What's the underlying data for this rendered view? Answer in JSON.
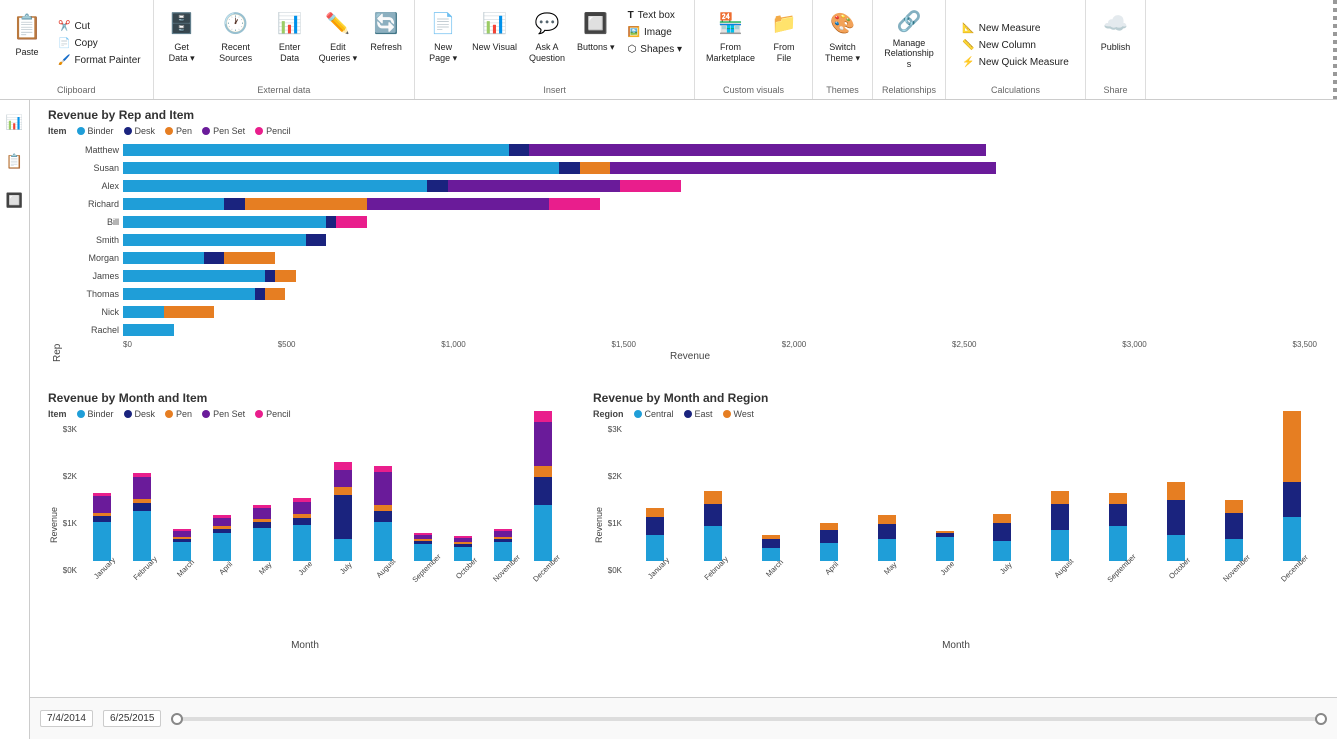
{
  "ribbon": {
    "groups": [
      {
        "name": "clipboard",
        "label": "Clipboard",
        "buttons": [
          {
            "id": "paste",
            "icon": "📋",
            "label": "Paste",
            "size": "large"
          },
          {
            "id": "cut",
            "icon": "✂️",
            "label": "Cut",
            "size": "small"
          },
          {
            "id": "copy",
            "icon": "📄",
            "label": "Copy",
            "size": "small"
          },
          {
            "id": "format-painter",
            "icon": "🖌️",
            "label": "Format Painter",
            "size": "small"
          }
        ]
      },
      {
        "name": "external-data",
        "label": "External data",
        "buttons": [
          {
            "id": "get-data",
            "icon": "🗄️",
            "label": "Get Data",
            "size": "large"
          },
          {
            "id": "recent-sources",
            "icon": "🕐",
            "label": "Recent Sources",
            "size": "large"
          },
          {
            "id": "enter-data",
            "icon": "📊",
            "label": "Enter Data",
            "size": "large"
          },
          {
            "id": "edit-queries",
            "icon": "✏️",
            "label": "Edit Queries",
            "size": "large"
          },
          {
            "id": "refresh",
            "icon": "🔄",
            "label": "Refresh",
            "size": "large"
          }
        ]
      },
      {
        "name": "insert",
        "label": "Insert",
        "buttons": [
          {
            "id": "new-page",
            "icon": "📄",
            "label": "New Page",
            "size": "large"
          },
          {
            "id": "new-visual",
            "icon": "📊",
            "label": "New Visual",
            "size": "large"
          },
          {
            "id": "ask-a-question",
            "icon": "💬",
            "label": "Ask A Question",
            "size": "large"
          },
          {
            "id": "buttons",
            "icon": "🔲",
            "label": "Buttons",
            "size": "large"
          },
          {
            "id": "text-box",
            "icon": "T",
            "label": "Text box",
            "size": "small"
          },
          {
            "id": "image",
            "icon": "🖼️",
            "label": "Image",
            "size": "small"
          },
          {
            "id": "shapes",
            "icon": "⬡",
            "label": "Shapes",
            "size": "small"
          }
        ]
      },
      {
        "name": "custom-visuals",
        "label": "Custom visuals",
        "buttons": [
          {
            "id": "from-marketplace",
            "icon": "🏪",
            "label": "From Marketplace",
            "size": "large"
          },
          {
            "id": "from-file",
            "icon": "📁",
            "label": "From File",
            "size": "large"
          }
        ]
      },
      {
        "name": "themes",
        "label": "Themes",
        "buttons": [
          {
            "id": "switch-theme",
            "icon": "🎨",
            "label": "Switch Theme",
            "size": "large"
          }
        ]
      },
      {
        "name": "relationships",
        "label": "Relationships",
        "buttons": [
          {
            "id": "manage-relationships",
            "icon": "🔗",
            "label": "Manage Relationships",
            "size": "large"
          }
        ]
      },
      {
        "name": "calculations",
        "label": "Calculations",
        "buttons": [
          {
            "id": "new-measure",
            "icon": "📐",
            "label": "New Measure",
            "size": "small"
          },
          {
            "id": "new-column",
            "icon": "📏",
            "label": "New Column",
            "size": "small"
          },
          {
            "id": "new-quick-measure",
            "icon": "⚡",
            "label": "New Quick Measure",
            "size": "small"
          }
        ]
      },
      {
        "name": "share",
        "label": "Share",
        "buttons": [
          {
            "id": "publish",
            "icon": "☁️",
            "label": "Publish",
            "size": "large"
          }
        ]
      }
    ]
  },
  "charts": {
    "top": {
      "title": "Revenue by Rep and Item",
      "legend_label": "Item",
      "legend_items": [
        {
          "label": "Binder",
          "color": "#1f9ed8"
        },
        {
          "label": "Desk",
          "color": "#1a237e"
        },
        {
          "label": "Pen",
          "color": "#e67e22"
        },
        {
          "label": "Pen Set",
          "color": "#6a1b9a"
        },
        {
          "label": "Pencil",
          "color": "#e91e8c"
        }
      ],
      "reps": [
        {
          "name": "Matthew",
          "bars": [
            {
              "color": "#1f9ed8",
              "pct": 38
            },
            {
              "color": "#1a237e",
              "pct": 2
            },
            {
              "color": "#e67e22",
              "pct": 0
            },
            {
              "color": "#6a1b9a",
              "pct": 45
            },
            {
              "color": "#e91e8c",
              "pct": 0
            }
          ]
        },
        {
          "name": "Susan",
          "bars": [
            {
              "color": "#1f9ed8",
              "pct": 43
            },
            {
              "color": "#1a237e",
              "pct": 2
            },
            {
              "color": "#e67e22",
              "pct": 3
            },
            {
              "color": "#6a1b9a",
              "pct": 38
            },
            {
              "color": "#e91e8c",
              "pct": 0
            }
          ]
        },
        {
          "name": "Alex",
          "bars": [
            {
              "color": "#1f9ed8",
              "pct": 30
            },
            {
              "color": "#1a237e",
              "pct": 2
            },
            {
              "color": "#e67e22",
              "pct": 0
            },
            {
              "color": "#6a1b9a",
              "pct": 17
            },
            {
              "color": "#e91e8c",
              "pct": 6
            }
          ]
        },
        {
          "name": "Richard",
          "bars": [
            {
              "color": "#1f9ed8",
              "pct": 10
            },
            {
              "color": "#1a237e",
              "pct": 2
            },
            {
              "color": "#e67e22",
              "pct": 12
            },
            {
              "color": "#6a1b9a",
              "pct": 18
            },
            {
              "color": "#e91e8c",
              "pct": 5
            }
          ]
        },
        {
          "name": "Bill",
          "bars": [
            {
              "color": "#1f9ed8",
              "pct": 20
            },
            {
              "color": "#1a237e",
              "pct": 1
            },
            {
              "color": "#e67e22",
              "pct": 0
            },
            {
              "color": "#6a1b9a",
              "pct": 0
            },
            {
              "color": "#e91e8c",
              "pct": 3
            }
          ]
        },
        {
          "name": "Smith",
          "bars": [
            {
              "color": "#1f9ed8",
              "pct": 18
            },
            {
              "color": "#1a237e",
              "pct": 2
            },
            {
              "color": "#e67e22",
              "pct": 0
            },
            {
              "color": "#6a1b9a",
              "pct": 0
            },
            {
              "color": "#e91e8c",
              "pct": 0
            }
          ]
        },
        {
          "name": "Morgan",
          "bars": [
            {
              "color": "#1f9ed8",
              "pct": 8
            },
            {
              "color": "#1a237e",
              "pct": 2
            },
            {
              "color": "#e67e22",
              "pct": 5
            },
            {
              "color": "#6a1b9a",
              "pct": 0
            },
            {
              "color": "#e91e8c",
              "pct": 0
            }
          ]
        },
        {
          "name": "James",
          "bars": [
            {
              "color": "#1f9ed8",
              "pct": 14
            },
            {
              "color": "#1a237e",
              "pct": 1
            },
            {
              "color": "#e67e22",
              "pct": 2
            },
            {
              "color": "#6a1b9a",
              "pct": 0
            },
            {
              "color": "#e91e8c",
              "pct": 0
            }
          ]
        },
        {
          "name": "Thomas",
          "bars": [
            {
              "color": "#1f9ed8",
              "pct": 13
            },
            {
              "color": "#1a237e",
              "pct": 1
            },
            {
              "color": "#e67e22",
              "pct": 2
            },
            {
              "color": "#6a1b9a",
              "pct": 0
            },
            {
              "color": "#e91e8c",
              "pct": 0
            }
          ]
        },
        {
          "name": "Nick",
          "bars": [
            {
              "color": "#1f9ed8",
              "pct": 4
            },
            {
              "color": "#1a237e",
              "pct": 0
            },
            {
              "color": "#e67e22",
              "pct": 5
            },
            {
              "color": "#6a1b9a",
              "pct": 0
            },
            {
              "color": "#e91e8c",
              "pct": 0
            }
          ]
        },
        {
          "name": "Rachel",
          "bars": [
            {
              "color": "#1f9ed8",
              "pct": 5
            },
            {
              "color": "#1a237e",
              "pct": 0
            },
            {
              "color": "#e67e22",
              "pct": 0
            },
            {
              "color": "#6a1b9a",
              "pct": 0
            },
            {
              "color": "#e91e8c",
              "pct": 0
            }
          ]
        }
      ],
      "x_axis": [
        "$0",
        "$500",
        "$1,000",
        "$1,500",
        "$2,000",
        "$2,500",
        "$3,000",
        "$3,500"
      ],
      "x_title": "Revenue",
      "y_title": "Rep"
    },
    "bottom_left": {
      "title": "Revenue by Month and Item",
      "legend_label": "Item",
      "legend_items": [
        {
          "label": "Binder",
          "color": "#1f9ed8"
        },
        {
          "label": "Desk",
          "color": "#1a237e"
        },
        {
          "label": "Pen",
          "color": "#e67e22"
        },
        {
          "label": "Pen Set",
          "color": "#6a1b9a"
        },
        {
          "label": "Pencil",
          "color": "#e91e8c"
        }
      ],
      "months": [
        "January",
        "February",
        "March",
        "April",
        "May",
        "June",
        "July",
        "August",
        "September",
        "October",
        "November",
        "December"
      ],
      "month_data": [
        [
          70,
          10,
          5,
          30,
          5
        ],
        [
          90,
          15,
          8,
          40,
          8
        ],
        [
          35,
          5,
          3,
          10,
          3
        ],
        [
          50,
          8,
          5,
          15,
          5
        ],
        [
          60,
          10,
          6,
          20,
          6
        ],
        [
          65,
          12,
          7,
          22,
          7
        ],
        [
          40,
          80,
          15,
          30,
          15
        ],
        [
          70,
          20,
          10,
          60,
          10
        ],
        [
          30,
          5,
          3,
          8,
          3
        ],
        [
          25,
          5,
          3,
          8,
          3
        ],
        [
          35,
          5,
          4,
          10,
          4
        ],
        [
          100,
          50,
          20,
          80,
          20
        ]
      ],
      "x_title": "Month",
      "y_title": "Revenue",
      "y_labels": [
        "$0K",
        "$1K",
        "$2K",
        "$3K"
      ]
    },
    "bottom_right": {
      "title": "Revenue by Month and Region",
      "legend_label": "Region",
      "legend_items": [
        {
          "label": "Central",
          "color": "#1f9ed8"
        },
        {
          "label": "East",
          "color": "#1a237e"
        },
        {
          "label": "West",
          "color": "#e67e22"
        }
      ],
      "months": [
        "January",
        "February",
        "March",
        "April",
        "May",
        "June",
        "July",
        "August",
        "September",
        "October",
        "November",
        "December"
      ],
      "month_data": [
        [
          60,
          40,
          20
        ],
        [
          80,
          50,
          30
        ],
        [
          30,
          20,
          10
        ],
        [
          40,
          30,
          15
        ],
        [
          50,
          35,
          20
        ],
        [
          55,
          10,
          5
        ],
        [
          45,
          40,
          20
        ],
        [
          70,
          60,
          30
        ],
        [
          80,
          50,
          25
        ],
        [
          60,
          80,
          40
        ],
        [
          50,
          60,
          30
        ],
        [
          100,
          80,
          160
        ]
      ],
      "x_title": "Month",
      "y_title": "Revenue",
      "y_labels": [
        "$0K",
        "$1K",
        "$2K",
        "$3K"
      ]
    }
  },
  "date_range": {
    "start": "7/4/2014",
    "end": "6/25/2015"
  },
  "sidebar": {
    "icons": [
      "📊",
      "📋",
      "🔲"
    ]
  }
}
